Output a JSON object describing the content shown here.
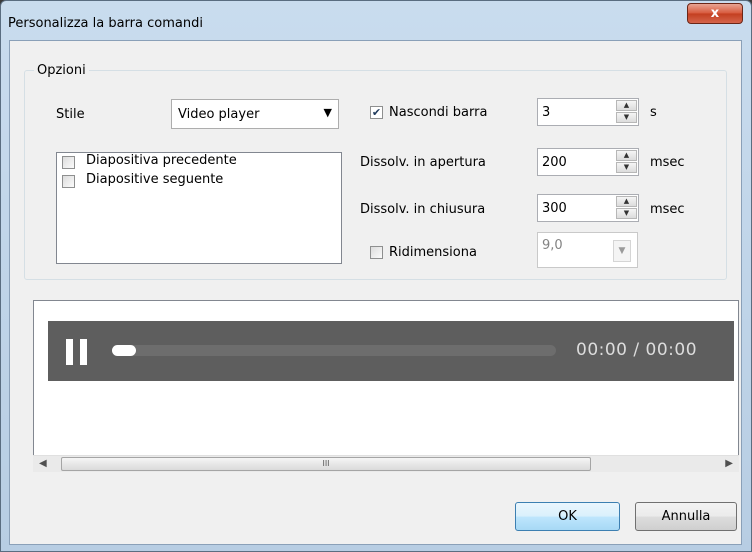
{
  "window": {
    "title": "Personalizza la barra comandi",
    "close_glyph": "x"
  },
  "options": {
    "legend": "Opzioni",
    "style_label": "Stile",
    "style_value": "Video player",
    "commands": [
      {
        "label": "Diapositiva precedente",
        "checked": false
      },
      {
        "label": "Diapositive seguente",
        "checked": false
      }
    ],
    "hide_bar": {
      "label": "Nascondi barra",
      "checked": true,
      "value": "3",
      "unit": "s"
    },
    "fade_in": {
      "label": "Dissolv. in apertura",
      "value": "200",
      "unit": "msec"
    },
    "fade_out": {
      "label": "Dissolv. in chiusura",
      "value": "300",
      "unit": "msec"
    },
    "resize": {
      "label": "Ridimensiona",
      "checked": false,
      "value": "9,0"
    }
  },
  "preview": {
    "timecode": "00:00 / 00:00",
    "progress": 0.0,
    "scroll_marker": "III"
  },
  "buttons": {
    "ok": "OK",
    "cancel": "Annulla"
  }
}
